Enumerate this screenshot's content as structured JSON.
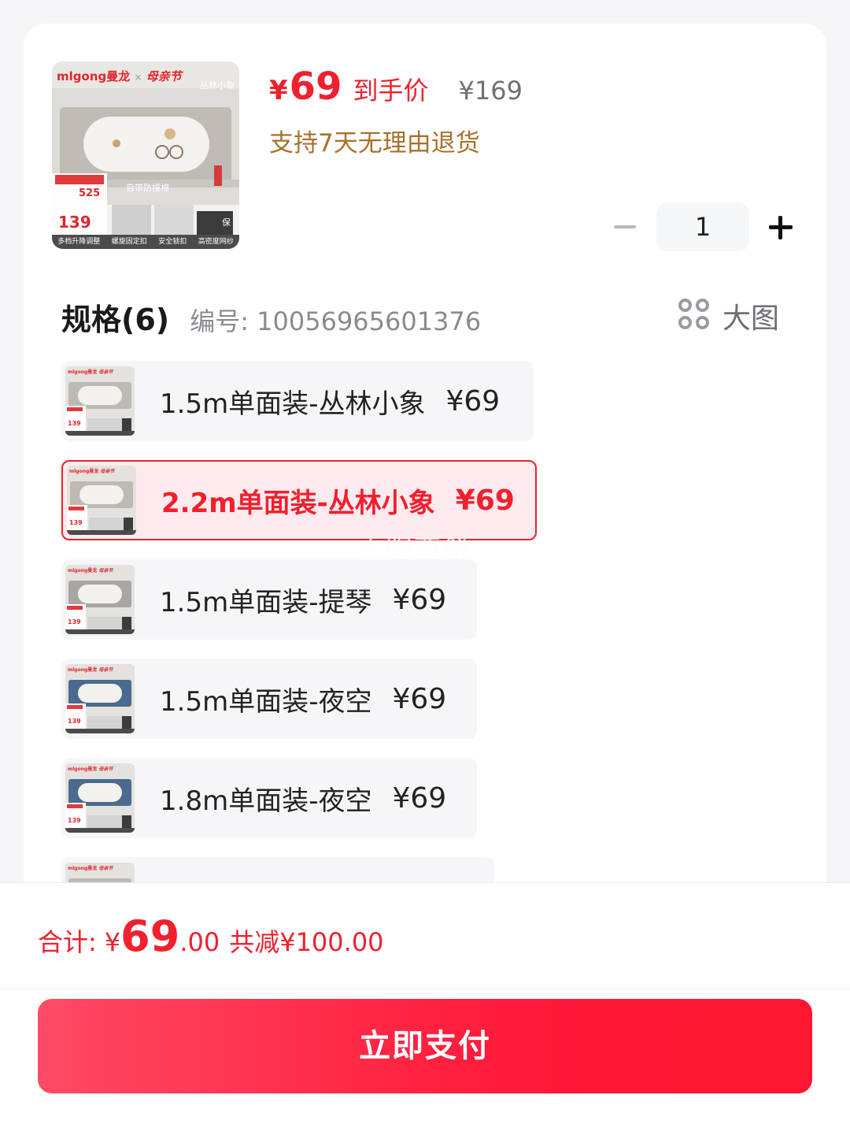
{
  "product": {
    "price_symbol": "¥",
    "price": "69",
    "price_tag": "到手价",
    "original_price": "¥169",
    "return_policy": "支持7天无理由退货",
    "thumbnail": {
      "brand": "mlgong曼龙",
      "cross": "×",
      "campaign": "母亲节",
      "series": "丛林小象",
      "caption": "自带防撞棉",
      "promo_price": "139",
      "coupon_value": "525",
      "feature_tags": [
        "多档升降调整",
        "螺旋固定扣",
        "安全锁扣",
        "高密度网纱"
      ],
      "badge": "保"
    }
  },
  "quantity": {
    "value": "1"
  },
  "spec": {
    "title": "规格(6)",
    "code": "编号: 10056965601376",
    "big_image_label": "大图"
  },
  "options": [
    {
      "name": "1.5m单面装-丛林小象",
      "price": "¥69",
      "selected": false,
      "color": "#bdbab3"
    },
    {
      "name": "2.2m单面装-丛林小象",
      "price": "¥69",
      "selected": true,
      "color": "#bdbab3"
    },
    {
      "name": "1.5m单面装-提琴",
      "price": "¥69",
      "selected": false,
      "color": "#a7a6a3"
    },
    {
      "name": "1.5m单面装-夜空",
      "price": "¥69",
      "selected": false,
      "color": "#4a6a8e"
    },
    {
      "name": "1.8m单面装-夜空",
      "price": "¥69",
      "selected": false,
      "color": "#4a6a8e"
    },
    {
      "name": "",
      "price": "",
      "selected": false,
      "color": "#bdbab3"
    }
  ],
  "option_thumb_text": {
    "brand": "mlgong曼龙",
    "campaign": "母亲节",
    "promo_price": "139"
  },
  "watermark": "太阳西斜",
  "footer": {
    "total_label": "合计:",
    "total_symbol": "¥",
    "total_int": "69",
    "total_dec": ".00",
    "saved": "共减¥100.00",
    "pay_button": "立即支付"
  },
  "colors": {
    "accent": "#f0202e",
    "policy": "#a8702c"
  }
}
